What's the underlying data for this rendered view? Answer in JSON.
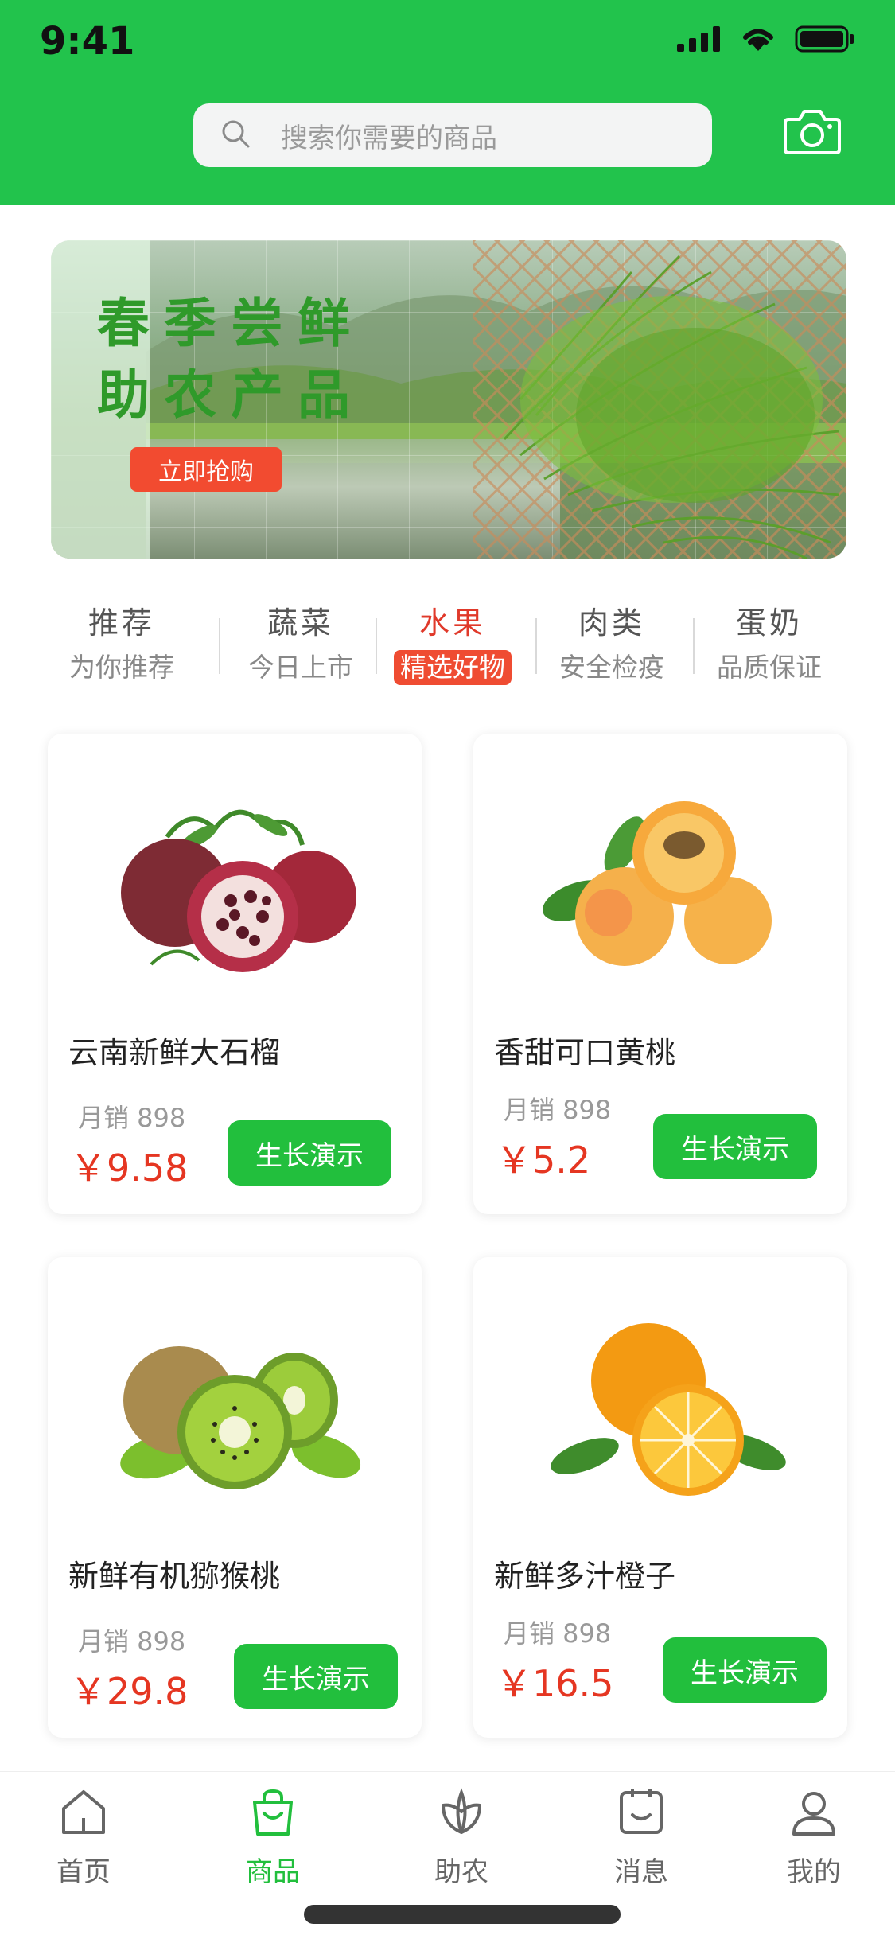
{
  "status_bar": {
    "time": "9:41"
  },
  "search": {
    "placeholder": "搜索你需要的商品"
  },
  "banner": {
    "title_line1": "春季尝鲜",
    "title_line2": "助农产品",
    "button": "立即抢购"
  },
  "categories": [
    {
      "title": "推荐",
      "subtitle": "为你推荐",
      "active": false
    },
    {
      "title": "蔬菜",
      "subtitle": "今日上市",
      "active": false
    },
    {
      "title": "水果",
      "subtitle": "精选好物",
      "active": true
    },
    {
      "title": "肉类",
      "subtitle": "安全检疫",
      "active": false
    },
    {
      "title": "蛋奶",
      "subtitle": "品质保证",
      "active": false
    }
  ],
  "products": [
    {
      "name": "云南新鲜大石榴",
      "sales": "月销 898",
      "price": "￥9.58",
      "button": "生长演示",
      "icon": "pomegranate-icon"
    },
    {
      "name": "香甜可口黄桃",
      "sales": "月销 898",
      "price": "￥5.2",
      "button": "生长演示",
      "icon": "apricot-icon"
    },
    {
      "name": "新鲜有机猕猴桃",
      "sales": "月销  898",
      "price": "￥29.8",
      "button": "生长演示",
      "icon": "kiwi-icon"
    },
    {
      "name": "新鲜多汁橙子",
      "sales": "月销  898",
      "price": "￥16.5",
      "button": "生长演示",
      "icon": "orange-icon"
    }
  ],
  "tabbar": [
    {
      "label": "首页",
      "icon": "home-icon",
      "active": false
    },
    {
      "label": "商品",
      "icon": "shopping-bag-icon",
      "active": true
    },
    {
      "label": "助农",
      "icon": "leaf-icon",
      "active": false
    },
    {
      "label": "消息",
      "icon": "message-icon",
      "active": false
    },
    {
      "label": "我的",
      "icon": "user-icon",
      "active": false
    }
  ],
  "colors": {
    "brand_green": "#22c34c",
    "price_red": "#e53622",
    "accent_red": "#ef4c32"
  }
}
